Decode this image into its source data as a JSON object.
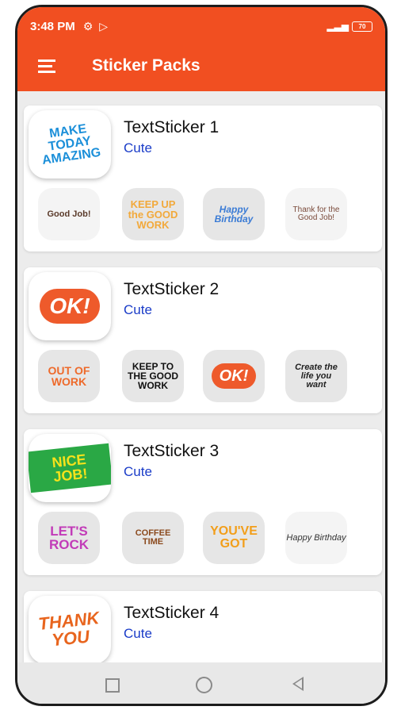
{
  "status_bar": {
    "time": "3:48 PM",
    "battery": "70"
  },
  "app_bar": {
    "title": "Sticker Packs"
  },
  "packs": [
    {
      "name": "TextSticker 1",
      "publisher": "Cute",
      "tray": {
        "text": "MAKE TODAY AMAZING",
        "color": "#1b8fd9"
      },
      "stickers": [
        {
          "text": "Good Job!",
          "color": "#5a3a2a"
        },
        {
          "text": "KEEP UP the GOOD WORK",
          "color": "#f2a93b"
        },
        {
          "text": "Happy Birthday",
          "color": "#3a7bd5"
        },
        {
          "text": "Thank for the Good Job!",
          "color": "#7a4a3a"
        }
      ]
    },
    {
      "name": "TextSticker 2",
      "publisher": "Cute",
      "tray": {
        "text": "OK!",
        "color": "#ee5a2b"
      },
      "stickers": [
        {
          "text": "OUT OF WORK",
          "color": "#ee6a2b"
        },
        {
          "text": "KEEP TO THE GOOD WORK",
          "color": "#111111"
        },
        {
          "text": "OK!",
          "color": "#ee5a2b"
        },
        {
          "text": "Create the life you want",
          "color": "#222222"
        }
      ]
    },
    {
      "name": "TextSticker 3",
      "publisher": "Cute",
      "tray": {
        "text": "NICE JOB!",
        "color": "#2aa845"
      },
      "stickers": [
        {
          "text": "LET'S ROCK",
          "color": "#c23bb8"
        },
        {
          "text": "COFFEE TIME",
          "color": "#8b4a1e"
        },
        {
          "text": "YOU'VE GOT",
          "color": "#f29e1a"
        },
        {
          "text": "Happy Birthday",
          "color": "#333333"
        }
      ]
    },
    {
      "name": "TextSticker 4",
      "publisher": "Cute",
      "tray": {
        "text": "THANK YOU",
        "color": "#e8651e"
      },
      "stickers": []
    }
  ]
}
